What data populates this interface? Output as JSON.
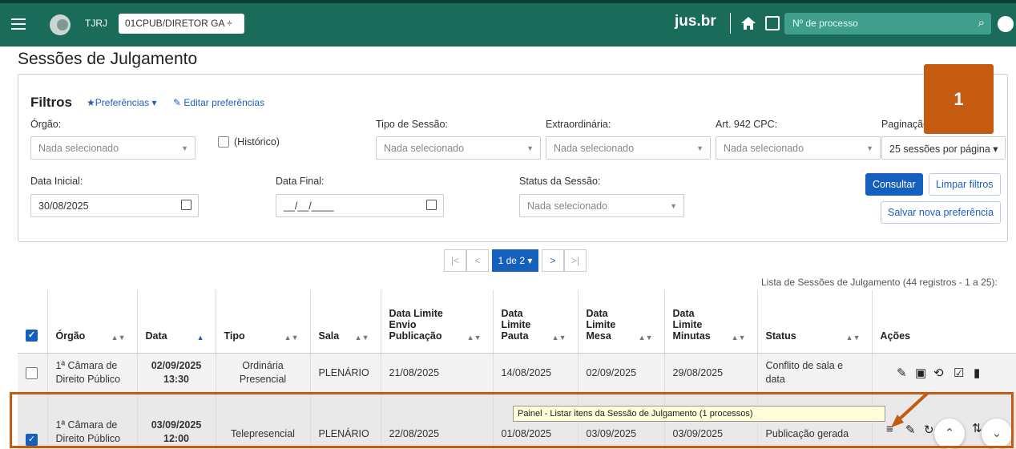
{
  "header": {
    "tribunal": "TJRJ",
    "org_select": "01CPUB/DIRETOR GA ÷",
    "brand": "jus.br",
    "process_placeholder": "Nº de processo"
  },
  "page": {
    "title": "Sessões de Julgamento",
    "annotation_number": "1"
  },
  "filters": {
    "title": "Filtros",
    "preferences": "Preferências ▾",
    "edit_preferences": "Editar preferências",
    "orgao_label": "Órgão:",
    "orgao_value": "Nada selecionado",
    "historico_label": "(Histórico)",
    "tipo_label": "Tipo de Sessão:",
    "tipo_value": "Nada selecionado",
    "extra_label": "Extraordinária:",
    "extra_value": "Nada selecionado",
    "art_label": "Art. 942 CPC:",
    "art_value": "Nada selecionado",
    "pag_label": "Paginação:",
    "pag_value": "25 sessões por página ▾",
    "data_ini_label": "Data Inicial:",
    "data_ini_value": "30/08/2025",
    "data_fim_label": "Data Final:",
    "data_fim_value": "__/__/____",
    "status_label": "Status da Sessão:",
    "status_value": "Nada selecionado",
    "consultar": "Consultar",
    "limpar": "Limpar filtros",
    "salvar": "Salvar nova preferência"
  },
  "pager": {
    "first": "|<",
    "prev": "<",
    "current": "1 de 2 ▾",
    "next": ">",
    "last": ">|"
  },
  "list_info": "Lista de Sessões de Julgamento (44 registros - 1 a 25):",
  "table": {
    "headers": [
      "Órgão",
      "Data",
      "Tipo",
      "Sala",
      "Data Limite Envio Publicação",
      "Data Limite Pauta",
      "Data Limite Mesa",
      "Data Limite Minutas",
      "Status",
      "Ações"
    ],
    "rows": [
      {
        "orgao": "1ª Câmara de Direito Público",
        "data": "02/09/2025",
        "hora": "13:30",
        "tipo": "Ordinária Presencial",
        "sala": "PLENÁRIO",
        "envio": "21/08/2025",
        "pauta": "14/08/2025",
        "mesa": "02/09/2025",
        "minutas": "29/08/2025",
        "status": "Conflito de sala e data",
        "checked": false
      },
      {
        "orgao": "1ª Câmara de Direito Público",
        "data": "03/09/2025",
        "hora": "12:00",
        "tipo": "Telepresencial",
        "sala": "PLENÁRIO",
        "envio": "22/08/2025",
        "pauta": "01/08/2025",
        "mesa": "03/09/2025",
        "minutas": "03/09/2025",
        "status": "Publicação gerada",
        "checked": true
      }
    ]
  },
  "tooltip": "Painel - Listar itens da Sessão de Julgamento (1 processos)",
  "colors": {
    "topbar": "#1b6b5a",
    "accent": "#1560bd",
    "highlight": "#c55a11"
  }
}
